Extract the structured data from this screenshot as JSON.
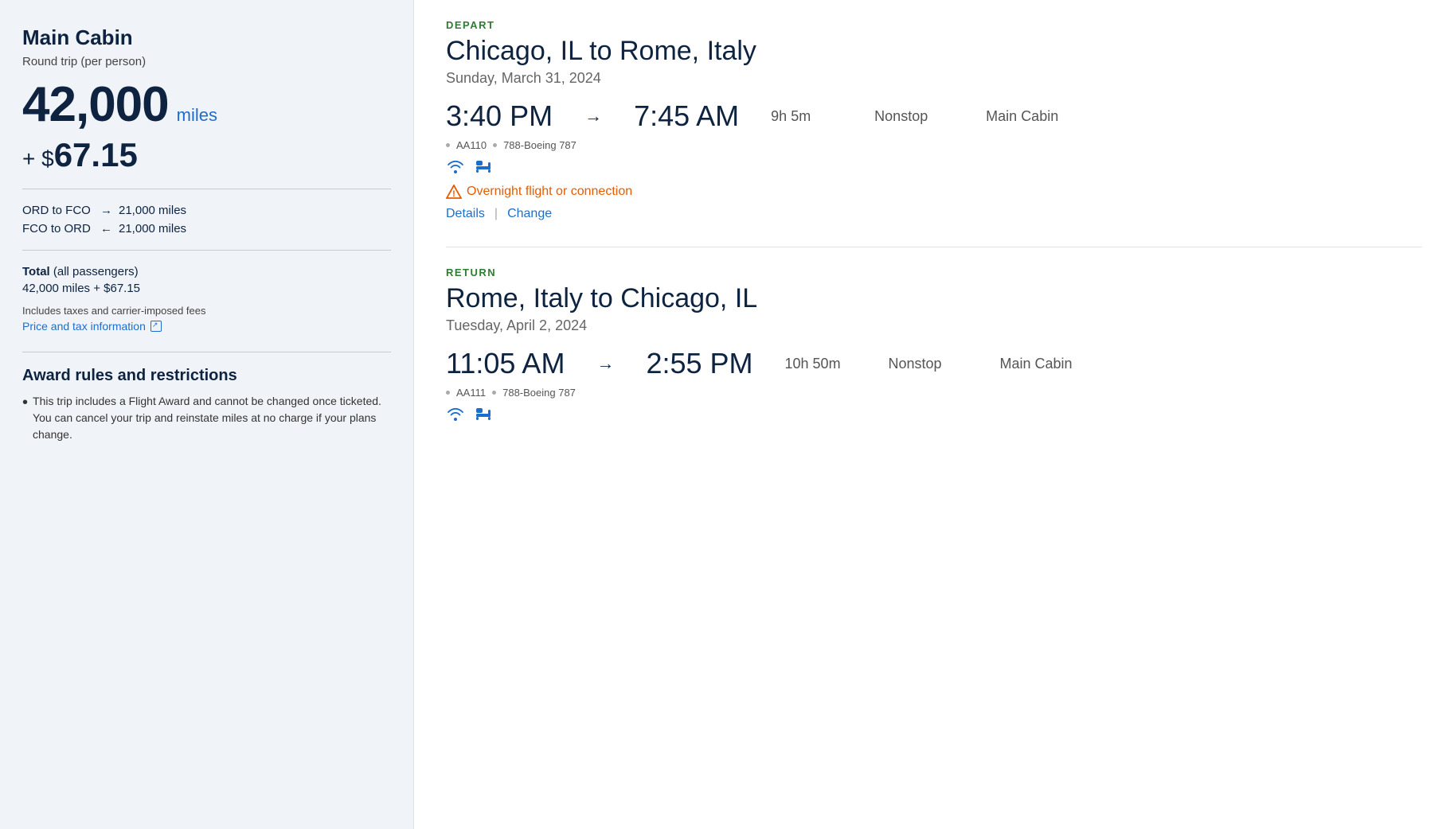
{
  "left": {
    "cabin_title": "Main Cabin",
    "round_trip_label": "Round trip (per person)",
    "miles_amount": "42,000",
    "miles_label": "miles",
    "tax_prefix": "+ $",
    "tax_amount": "67.15",
    "routes": [
      {
        "origin": "ORD to FCO",
        "arrow": "→",
        "miles": "21,000 miles"
      },
      {
        "origin": "FCO to ORD",
        "arrow": "←",
        "miles": "21,000 miles"
      }
    ],
    "total_label": "Total (all passengers)",
    "total_value": "42,000 miles + $67.15",
    "taxes_note": "Includes taxes and carrier-imposed fees",
    "price_tax_link": "Price and tax information",
    "award_rules_title": "Award rules and restrictions",
    "award_rules_bullet": "This trip includes a Flight Award and cannot be changed once ticketed. You can cancel your trip and reinstate miles at no charge if your plans change."
  },
  "right": {
    "depart": {
      "section_label": "DEPART",
      "route_title": "Chicago, IL to Rome, Italy",
      "date": "Sunday, March 31, 2024",
      "depart_time": "3:40 PM",
      "arrive_time": "7:45 AM",
      "duration": "9h 5m",
      "stop_type": "Nonstop",
      "cabin_class": "Main Cabin",
      "flight_number": "AA110",
      "aircraft": "788-Boeing 787",
      "overnight_warning": "Overnight flight or connection",
      "details_link": "Details",
      "change_link": "Change"
    },
    "return": {
      "section_label": "RETURN",
      "route_title": "Rome, Italy to Chicago, IL",
      "date": "Tuesday, April 2, 2024",
      "depart_time": "11:05 AM",
      "arrive_time": "2:55 PM",
      "duration": "10h 50m",
      "stop_type": "Nonstop",
      "cabin_class": "Main Cabin",
      "flight_number": "AA111",
      "aircraft": "788-Boeing 787"
    }
  }
}
